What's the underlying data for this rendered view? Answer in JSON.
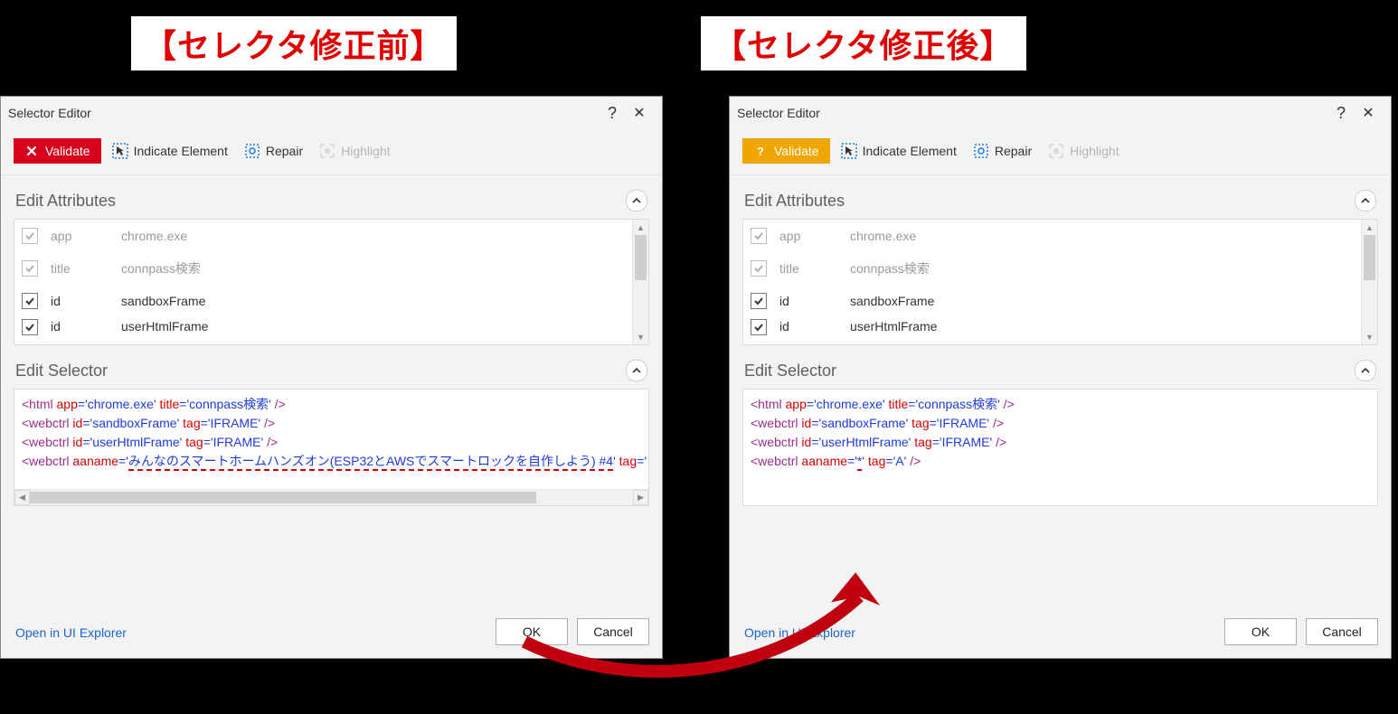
{
  "header": {
    "before": "【セレクタ修正前】",
    "after": "【セレクタ修正後】"
  },
  "dialog": {
    "title": "Selector Editor",
    "help_label": "?",
    "close_label": "✕"
  },
  "toolbar": {
    "validate": "Validate",
    "indicate": "Indicate Element",
    "repair": "Repair",
    "highlight": "Highlight"
  },
  "sections": {
    "attrs": "Edit Attributes",
    "selector": "Edit Selector"
  },
  "attrs": [
    {
      "name": "app",
      "value": "chrome.exe",
      "checked": true,
      "enabled": false
    },
    {
      "name": "title",
      "value": "connpass検索",
      "checked": true,
      "enabled": false
    },
    {
      "name": "id",
      "value": "sandboxFrame",
      "checked": true,
      "enabled": true
    },
    {
      "name": "id",
      "value": "userHtmlFrame",
      "checked": true,
      "enabled": true
    }
  ],
  "selector_before": {
    "lines": [
      {
        "tag": "html",
        "pairs": [
          {
            "k": "app",
            "v": "chrome.exe"
          },
          {
            "k": "title",
            "v": "connpass検索"
          }
        ]
      },
      {
        "tag": "webctrl",
        "pairs": [
          {
            "k": "id",
            "v": "sandboxFrame"
          },
          {
            "k": "tag",
            "v": "IFRAME"
          }
        ]
      },
      {
        "tag": "webctrl",
        "pairs": [
          {
            "k": "id",
            "v": "userHtmlFrame"
          },
          {
            "k": "tag",
            "v": "IFRAME"
          }
        ]
      },
      {
        "tag": "webctrl",
        "pairs": [
          {
            "k": "aaname",
            "v": "みんなのスマートホームハンズオン(ESP32とAWSでスマートロックを自作しよう) #4",
            "underline": true
          },
          {
            "k": "tag",
            "v": "",
            "truncated": true
          }
        ]
      }
    ]
  },
  "selector_after": {
    "lines": [
      {
        "tag": "html",
        "pairs": [
          {
            "k": "app",
            "v": "chrome.exe"
          },
          {
            "k": "title",
            "v": "connpass検索"
          }
        ]
      },
      {
        "tag": "webctrl",
        "pairs": [
          {
            "k": "id",
            "v": "sandboxFrame"
          },
          {
            "k": "tag",
            "v": "IFRAME"
          }
        ]
      },
      {
        "tag": "webctrl",
        "pairs": [
          {
            "k": "id",
            "v": "userHtmlFrame"
          },
          {
            "k": "tag",
            "v": "IFRAME"
          }
        ]
      },
      {
        "tag": "webctrl",
        "pairs": [
          {
            "k": "aaname",
            "v": "*",
            "underline": true
          },
          {
            "k": "tag",
            "v": "A"
          }
        ]
      }
    ]
  },
  "open_link": "Open in UI Explorer",
  "buttons": {
    "ok": "OK",
    "cancel": "Cancel"
  }
}
